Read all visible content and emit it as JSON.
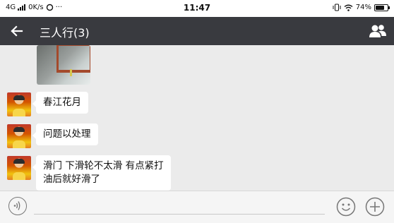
{
  "status_bar": {
    "network": "4G",
    "speed": "0K/s",
    "icons_left": [
      "signal-bars-icon",
      "notification-icon",
      "more-dots-icon"
    ],
    "time": "11:47",
    "icons_right": [
      "vibrate-icon",
      "wifi-icon",
      "battery-icon"
    ],
    "battery": "74%",
    "battery_level": 0.74
  },
  "header": {
    "title": "三人行(3)",
    "left_icon": "back-arrow-icon",
    "right_icon": "group-members-icon"
  },
  "messages": [
    {
      "type": "image",
      "content": "shared-photo"
    },
    {
      "type": "text",
      "avatar": "child-avatar",
      "text": "春江花月"
    },
    {
      "type": "text",
      "avatar": "child-avatar",
      "text": "问题以处理"
    },
    {
      "type": "text",
      "avatar": "child-avatar",
      "text_line1": "滑门  下滑轮不太滑  有点紧打",
      "text_line2": "油后就好滑了"
    }
  ],
  "input_bar": {
    "left_icon": "voice-input-icon",
    "emoji_icon": "emoji-icon",
    "plus_icon": "plus-icon"
  },
  "colors": {
    "header_bg": "#393a3f",
    "chat_bg": "#ebebeb",
    "bubble_bg": "#ffffff"
  }
}
